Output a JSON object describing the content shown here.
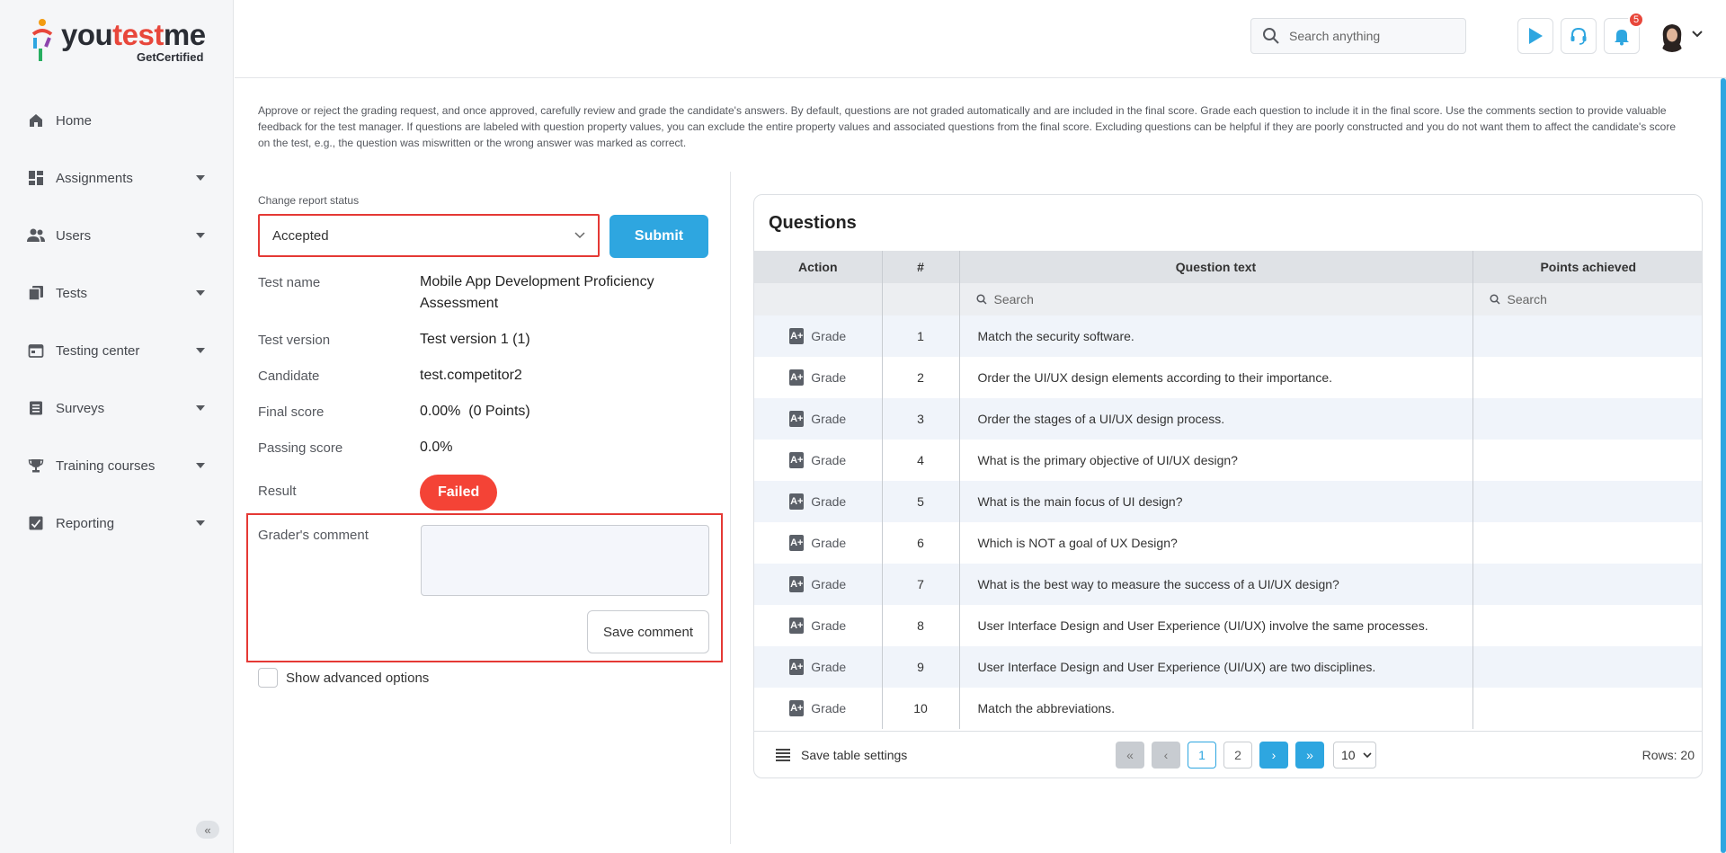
{
  "brand": {
    "name_part1": "you",
    "name_part2": "test",
    "name_part3": "me",
    "tagline": "GetCertified"
  },
  "sidebar": {
    "items": [
      {
        "label": "Home",
        "icon": "home-icon",
        "expandable": false
      },
      {
        "label": "Assignments",
        "icon": "dashboard-icon",
        "expandable": true
      },
      {
        "label": "Users",
        "icon": "users-icon",
        "expandable": true
      },
      {
        "label": "Tests",
        "icon": "copy-icon",
        "expandable": true
      },
      {
        "label": "Testing center",
        "icon": "calendar-icon",
        "expandable": true
      },
      {
        "label": "Surveys",
        "icon": "list-icon",
        "expandable": true
      },
      {
        "label": "Training courses",
        "icon": "trophy-icon",
        "expandable": true
      },
      {
        "label": "Reporting",
        "icon": "chart-icon",
        "expandable": true
      }
    ]
  },
  "header": {
    "search_placeholder": "Search anything",
    "notifications_count": "5"
  },
  "main": {
    "intro": "Approve or reject the grading request, and once approved, carefully review and grade the candidate's answers. By default, questions are not graded automatically and are included in the final score. Grade each question to include it in the final score. Use the comments section to provide valuable feedback for the test manager. If questions are labeled with question property values, you can exclude the entire property values and associated questions from the final score. Excluding questions can be helpful if they are poorly constructed and you do not want them to affect the candidate's score on the test, e.g., the question was miswritten or the wrong answer was marked as correct.",
    "status_label": "Change report status",
    "status_value": "Accepted",
    "submit_label": "Submit",
    "info": {
      "test_name_label": "Test name",
      "test_name": "Mobile App Development Proficiency Assessment",
      "test_version_label": "Test version",
      "test_version": "Test version 1 (1)",
      "candidate_label": "Candidate",
      "candidate": "test.competitor2",
      "final_score_label": "Final score",
      "final_score": "0.00%  (0 Points)",
      "passing_score_label": "Passing score",
      "passing_score": "0.0%",
      "result_label": "Result",
      "result": "Failed"
    },
    "comment_label": "Grader's comment",
    "comment_value": "",
    "save_comment_label": "Save comment",
    "advanced_label": "Show advanced options"
  },
  "questions": {
    "title": "Questions",
    "columns": [
      "Action",
      "#",
      "Question text",
      "Points achieved"
    ],
    "filter_placeholder": "Search",
    "grade_label": "Grade",
    "rows": [
      {
        "num": "1",
        "text": "Match the security software.",
        "points": ""
      },
      {
        "num": "2",
        "text": "Order the UI/UX design elements according to their importance.",
        "points": ""
      },
      {
        "num": "3",
        "text": "Order the stages of a UI/UX design process.",
        "points": ""
      },
      {
        "num": "4",
        "text": "What is the primary objective of UI/UX design?",
        "points": ""
      },
      {
        "num": "5",
        "text": "What is the main focus of UI design?",
        "points": ""
      },
      {
        "num": "6",
        "text": "Which is NOT a goal of UX Design?",
        "points": ""
      },
      {
        "num": "7",
        "text": "What is the best way to measure the success of a UI/UX design?",
        "points": ""
      },
      {
        "num": "8",
        "text": "User Interface Design and User Experience (UI/UX) involve the same processes.",
        "points": ""
      },
      {
        "num": "9",
        "text": "User Interface Design and User Experience (UI/UX) are two disciplines.",
        "points": ""
      },
      {
        "num": "10",
        "text": "Match the abbreviations.",
        "points": ""
      }
    ],
    "footer": {
      "save_settings_label": "Save table settings",
      "pages": [
        "1",
        "2"
      ],
      "current_page": "1",
      "page_size": "10",
      "rows_count": "Rows: 20"
    }
  },
  "colors": {
    "accent": "#2ea6e0",
    "danger": "#f44336",
    "highlight": "#e53935"
  }
}
